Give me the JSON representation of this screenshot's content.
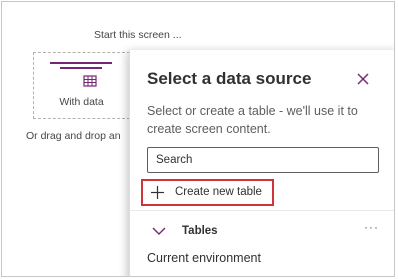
{
  "canvas": {
    "start_title": "Start this screen ...",
    "with_data_label": "With data",
    "drag_text": "Or drag and drop an"
  },
  "panel": {
    "title": "Select a data source",
    "description": "Select or create a table - we'll use it to create screen content.",
    "search_placeholder": "Search",
    "create_label": "Create new table",
    "section_label": "Tables",
    "more_label": "···",
    "environment_label": "Current environment"
  },
  "colors": {
    "accent": "#742774",
    "highlight_border": "#d13438"
  },
  "icons": {
    "close": "close-icon",
    "add": "plus-icon",
    "section": "chevron-down-icon"
  }
}
